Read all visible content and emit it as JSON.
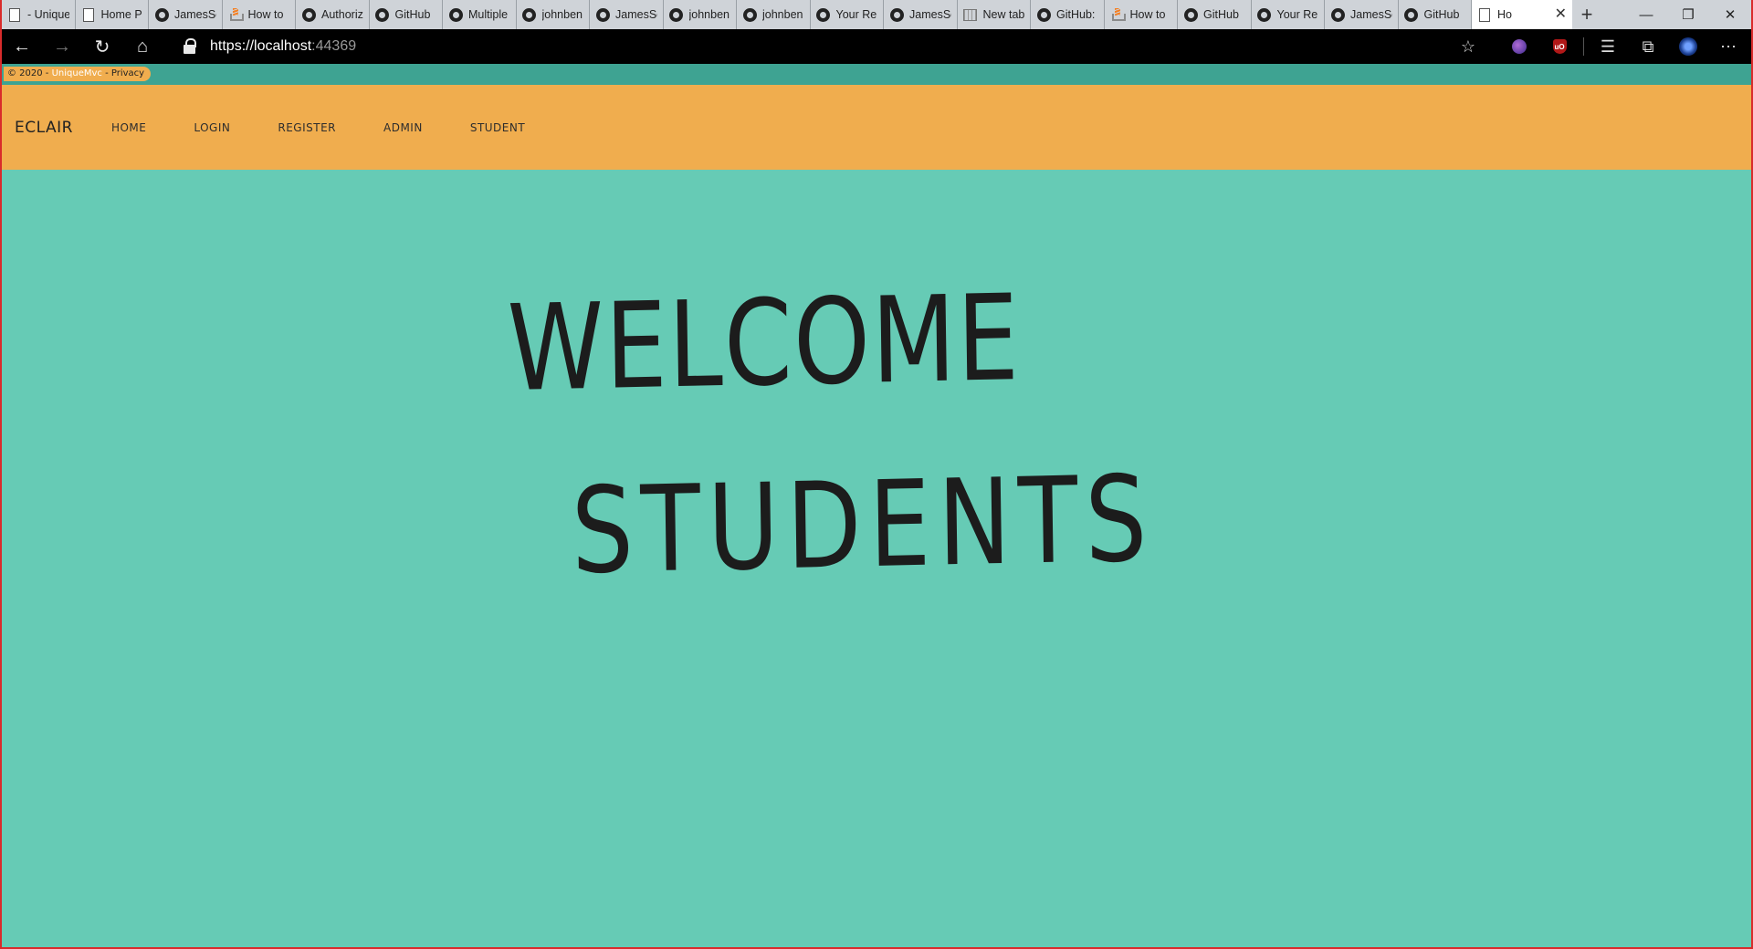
{
  "browser": {
    "tabs": [
      {
        "label": "- Unique",
        "favicon": "page-icon"
      },
      {
        "label": "Home P",
        "favicon": "page-icon"
      },
      {
        "label": "JamesSc",
        "favicon": "github-icon"
      },
      {
        "label": "How to",
        "favicon": "stackoverflow-icon"
      },
      {
        "label": "Authoriz",
        "favicon": "github-icon"
      },
      {
        "label": "GitHub",
        "favicon": "github-icon"
      },
      {
        "label": "Multiple",
        "favicon": "github-icon"
      },
      {
        "label": "johnben",
        "favicon": "github-icon"
      },
      {
        "label": "JamesSc",
        "favicon": "github-icon"
      },
      {
        "label": "johnben",
        "favicon": "github-icon"
      },
      {
        "label": "johnben",
        "favicon": "github-icon"
      },
      {
        "label": "Your Re",
        "favicon": "github-icon"
      },
      {
        "label": "JamesSc",
        "favicon": "github-icon"
      },
      {
        "label": "New tab",
        "favicon": "grid-icon"
      },
      {
        "label": "GitHub:",
        "favicon": "github-icon"
      },
      {
        "label": "How to",
        "favicon": "stackoverflow-icon"
      },
      {
        "label": "GitHub",
        "favicon": "github-icon"
      },
      {
        "label": "Your Re",
        "favicon": "github-icon"
      },
      {
        "label": "JamesSc",
        "favicon": "github-icon"
      },
      {
        "label": "GitHub",
        "favicon": "github-icon"
      }
    ],
    "active_tab": {
      "label": "Ho",
      "favicon": "page-icon",
      "close": "✕"
    },
    "new_tab_symbol": "+",
    "caption": {
      "minimize": "—",
      "restore": "❐",
      "close": "✕"
    },
    "nav": {
      "back": "←",
      "forward": "→",
      "refresh": "↻",
      "home": "⌂"
    },
    "address": {
      "host": "https://localhost",
      "port": ":44369"
    },
    "favorite_star": "☆",
    "toolbar_icons": {
      "favorites": "☰",
      "collections": "⧉",
      "more": "⋯"
    },
    "ublock_text": "uO"
  },
  "site": {
    "footer": {
      "prefix": "© 2020 - ",
      "brand": "UniqueMvc",
      "suffix": " - Privacy"
    },
    "navbar": {
      "brand": "ECLAIR",
      "links": [
        "HOME",
        "LOGIN",
        "REGISTER",
        "ADMIN",
        "STUDENT"
      ]
    },
    "hero": {
      "line1": "WELCOME",
      "line2": "STUDENTS"
    },
    "colors": {
      "navbar_bg": "#f0ad4e",
      "page_bg": "#66cbb5",
      "strip_bg": "#3ea392",
      "text": "#1c1c1c"
    }
  }
}
